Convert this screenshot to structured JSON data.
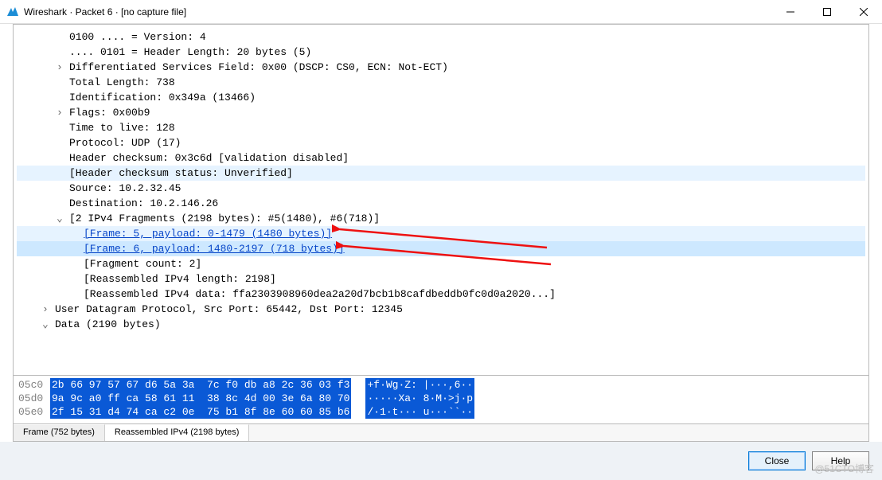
{
  "window": {
    "title": "Wireshark · Packet 6 · [no capture file]"
  },
  "tree": {
    "r0": "0100 .... = Version: 4",
    "r1": ".... 0101 = Header Length: 20 bytes (5)",
    "r2": "Differentiated Services Field: 0x00 (DSCP: CS0, ECN: Not-ECT)",
    "r3": "Total Length: 738",
    "r4": "Identification: 0x349a (13466)",
    "r5": "Flags: 0x00b9",
    "r6": "Time to live: 128",
    "r7": "Protocol: UDP (17)",
    "r8": "Header checksum: 0x3c6d [validation disabled]",
    "r9": "[Header checksum status: Unverified]",
    "r10": "Source: 10.2.32.45",
    "r11": "Destination: 10.2.146.26",
    "r12": "[2 IPv4 Fragments (2198 bytes): #5(1480), #6(718)]",
    "r13": "[Frame: 5, payload: 0-1479 (1480 bytes)]",
    "r14": "[Frame: 6, payload: 1480-2197 (718 bytes)]",
    "r15": "[Fragment count: 2]",
    "r16": "[Reassembled IPv4 length: 2198]",
    "r17": "[Reassembled IPv4 data: ffa2303908960dea2a20d7bcb1b8cafdbeddb0fc0d0a2020...]",
    "r18": "User Datagram Protocol, Src Port: 65442, Dst Port: 12345",
    "r19": "Data (2190 bytes)"
  },
  "hex": {
    "rows": [
      {
        "off": "05c0",
        "bytes": "2b 66 97 57 67 d6 5a 3a  7c f0 db a8 2c 36 03 f3",
        "asc": "+f·Wg·Z: |···,6··"
      },
      {
        "off": "05d0",
        "bytes": "9a 9c a0 ff ca 58 61 11  38 8c 4d 00 3e 6a 80 70",
        "asc": "·····Xa· 8·M·>j·p"
      },
      {
        "off": "05e0",
        "bytes": "2f 15 31 d4 74 ca c2 0e  75 b1 8f 8e 60 60 85 b6",
        "asc": "/·1·t··· u···``··"
      }
    ]
  },
  "tabs": {
    "t0": "Frame (752 bytes)",
    "t1": "Reassembled IPv4 (2198 bytes)"
  },
  "buttons": {
    "close": "Close",
    "help": "Help"
  },
  "watermark": "@51CTO博客"
}
